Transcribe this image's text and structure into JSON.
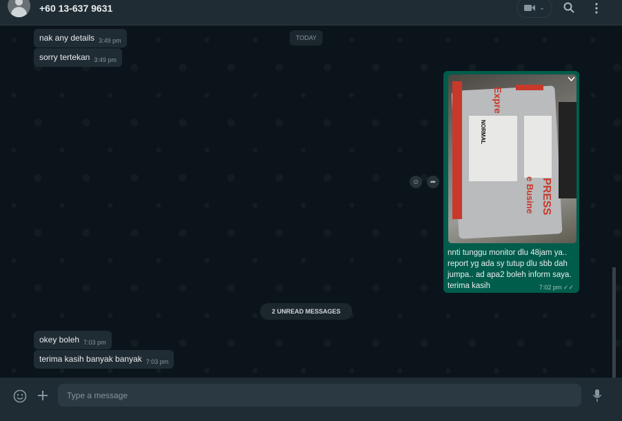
{
  "header": {
    "contact": "+60 13-637 9631"
  },
  "date_divider": "TODAY",
  "messages": [
    {
      "text": "nak any details",
      "time": "3:49 pm"
    },
    {
      "text": "sorry tertekan",
      "time": "3:49 pm"
    },
    {
      "caption_lines": [
        "nnti tunggu monitor dlu 48jam ya..",
        "report yg ada sy tutup dlu sbb dah",
        "jumpa.. ad apa2 boleh inform saya.",
        "terima kasih"
      ],
      "time": "7:02 pm"
    },
    {
      "text": "okey boleh",
      "time": "7:03 pm"
    },
    {
      "text": "terima kasih banyak banyak",
      "time": "7:03 pm"
    }
  ],
  "unread_divider": "2 UNREAD MESSAGES",
  "composer": {
    "placeholder": "Type a message"
  },
  "photo_lettering": [
    "Expre",
    "PRESS",
    "e Busine",
    "NORMAL"
  ]
}
